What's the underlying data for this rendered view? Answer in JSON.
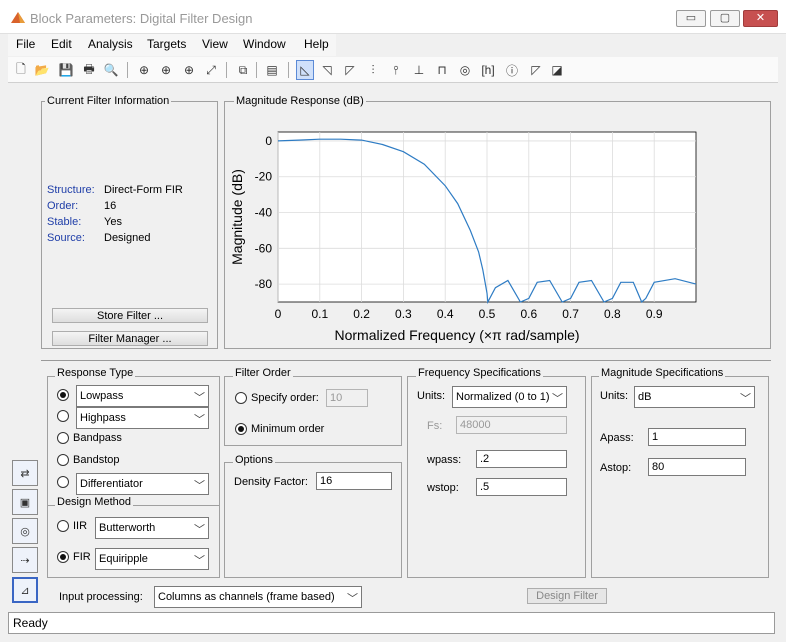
{
  "window": {
    "title": "Block Parameters: Digital Filter Design",
    "minimize": "▭",
    "maximize": "▢",
    "close": "✕"
  },
  "menu": [
    "File",
    "Edit",
    "Analysis",
    "Targets",
    "View",
    "Window",
    "Help"
  ],
  "toolbar_icons": [
    "new-file-icon",
    "open-folder-icon",
    "save-icon",
    "print-icon",
    "print-preview-icon",
    "zoom-in-icon",
    "zoom-x-icon",
    "zoom-y-icon",
    "full-view-icon",
    "new-window-icon",
    "legend-icon",
    "magnitude-response-icon",
    "phase-response-icon",
    "magnitude-phase-icon",
    "group-delay-icon",
    "phase-delay-icon",
    "impulse-response-icon",
    "step-response-icon",
    "pole-zero-icon",
    "filter-coefficients-icon",
    "filter-info-icon",
    "magnitude-estimate-icon",
    "round-off-noise-icon"
  ],
  "current_filter": {
    "title": "Current Filter Information",
    "rows": [
      {
        "key": "Structure:",
        "value": "Direct-Form FIR"
      },
      {
        "key": "Order:",
        "value": "16"
      },
      {
        "key": "Stable:",
        "value": "Yes"
      },
      {
        "key": "Source:",
        "value": "Designed"
      }
    ],
    "store_button": "Store Filter ...",
    "manager_button": "Filter Manager ..."
  },
  "plot_title": "Magnitude Response (dB)",
  "chart_data": {
    "type": "line",
    "title": "",
    "xlabel": "Normalized Frequency (×π rad/sample)",
    "ylabel": "Magnitude (dB)",
    "xlim": [
      0,
      1
    ],
    "ylim": [
      -90,
      5
    ],
    "xticks": [
      0,
      0.1,
      0.2,
      0.3,
      0.4,
      0.5,
      0.6,
      0.7,
      0.8,
      0.9
    ],
    "xtick_labels": [
      "0",
      "0.1",
      "0.2",
      "0.3",
      "0.4",
      "0.5",
      "0.6",
      "0.7",
      "0.8",
      "0.9"
    ],
    "yticks": [
      0,
      -20,
      -40,
      -60,
      -80
    ],
    "ytick_labels": [
      "0",
      "-20",
      "-40",
      "-60",
      "-80"
    ],
    "grid": true,
    "color": "#2e7cc4",
    "x": [
      0,
      0.05,
      0.1,
      0.15,
      0.2,
      0.25,
      0.3,
      0.35,
      0.4,
      0.43,
      0.46,
      0.48,
      0.49,
      0.5,
      0.502,
      0.52,
      0.55,
      0.58,
      0.6,
      0.62,
      0.65,
      0.68,
      0.7,
      0.72,
      0.75,
      0.78,
      0.8,
      0.82,
      0.85,
      0.87,
      0.88,
      0.9,
      0.95,
      1.0
    ],
    "y": [
      0,
      0.5,
      1,
      1,
      0.5,
      -2,
      -6,
      -13,
      -25,
      -35,
      -50,
      -62,
      -72,
      -85,
      -90,
      -82,
      -78,
      -90,
      -88,
      -79,
      -78,
      -90,
      -88,
      -79,
      -78,
      -90,
      -88,
      -79,
      -79,
      -90,
      -88,
      -79,
      -77,
      -80
    ]
  },
  "response_type": {
    "title": "Response Type",
    "lowpass": "Lowpass",
    "highpass": "Highpass",
    "bandpass": "Bandpass",
    "bandstop": "Bandstop",
    "differentiator": "Differentiator"
  },
  "design_method": {
    "title": "Design Method",
    "iir": "IIR",
    "iir_type": "Butterworth",
    "fir": "FIR",
    "fir_type": "Equiripple"
  },
  "filter_order": {
    "title": "Filter Order",
    "specify": "Specify order:",
    "specify_value": "10",
    "minimum": "Minimum order"
  },
  "options": {
    "title": "Options",
    "density_label": "Density Factor:",
    "density_value": "16"
  },
  "freq_spec": {
    "title": "Frequency Specifications",
    "units_label": "Units:",
    "units_value": "Normalized (0 to 1)",
    "fs_label": "Fs:",
    "fs_value": "48000",
    "wpass_label": "wpass:",
    "wpass_value": ".2",
    "wstop_label": "wstop:",
    "wstop_value": ".5"
  },
  "mag_spec": {
    "title": "Magnitude Specifications",
    "units_label": "Units:",
    "units_value": "dB",
    "apass_label": "Apass:",
    "apass_value": "1",
    "astop_label": "Astop:",
    "astop_value": "80"
  },
  "input_processing": {
    "label": "Input processing:",
    "value": "Columns as channels (frame based)"
  },
  "design_button": "Design Filter",
  "side_icons": [
    "transform-filter-icon",
    "realize-model-icon",
    "pole-zero-editor-icon",
    "import-filter-icon",
    "design-filter-icon"
  ],
  "status": "Ready"
}
